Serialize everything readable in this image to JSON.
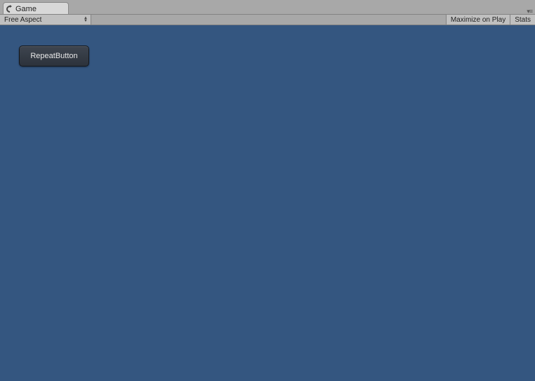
{
  "tab": {
    "title": "Game"
  },
  "toolbar": {
    "aspect_label": "Free Aspect",
    "maximize_label": "Maximize on Play",
    "stats_label": "Stats"
  },
  "viewport": {
    "button_label": "RepeatButton"
  },
  "colors": {
    "viewport_bg": "#345680"
  }
}
